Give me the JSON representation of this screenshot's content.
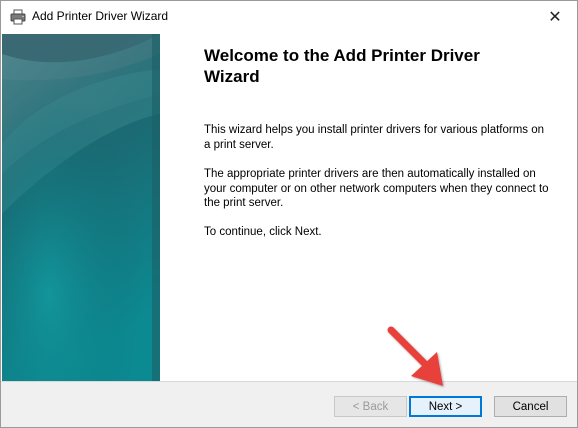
{
  "window": {
    "title": "Add Printer Driver Wizard",
    "close_glyph": "✕"
  },
  "content": {
    "heading": "Welcome to the Add Printer Driver Wizard",
    "paragraph1": "This wizard helps you install printer drivers for various platforms on a print server.",
    "paragraph2": "The appropriate printer drivers are then automatically installed on your computer or on other network computers when they connect to the print server.",
    "paragraph3": "To continue, click Next."
  },
  "buttons": {
    "back": "< Back",
    "next": "Next >",
    "cancel": "Cancel"
  },
  "colors": {
    "side_panel_top": "#2a5e6a",
    "side_panel_bottom": "#0f7f8a",
    "annotation_arrow": "#e8403a",
    "default_button_border": "#0078d7"
  },
  "icons": {
    "title_icon": "printer-icon",
    "close_icon": "close-icon",
    "annotation": "red-arrow-annotation"
  }
}
